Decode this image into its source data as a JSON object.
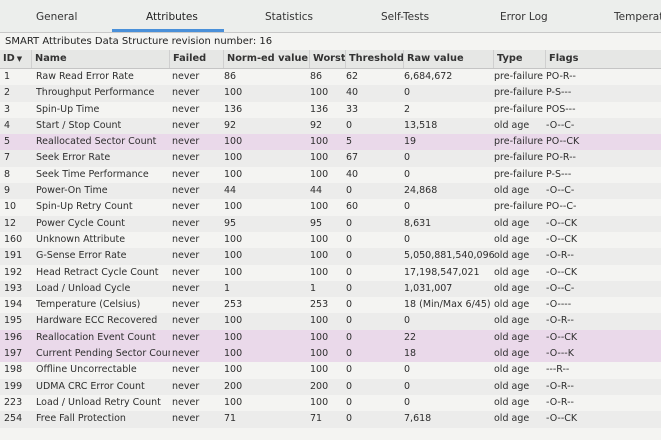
{
  "tabs": [
    {
      "label": "General"
    },
    {
      "label": "Attributes"
    },
    {
      "label": "Statistics"
    },
    {
      "label": "Self-Tests"
    },
    {
      "label": "Error Log"
    },
    {
      "label": "Temperatu"
    }
  ],
  "active_tab": "Attributes",
  "revision_text": "SMART Attributes Data Structure revision number: 16",
  "columns": [
    "ID",
    "Name",
    "Failed",
    "Norm-ed value",
    "Worst",
    "Threshold",
    "Raw value",
    "Type",
    "Flags"
  ],
  "sort_indicator": "▼",
  "rows": [
    {
      "id": "1",
      "name": "Raw Read Error Rate",
      "failed": "never",
      "norm": "86",
      "worst": "86",
      "threshold": "62",
      "raw": "6,684,672",
      "type": "pre-failure",
      "flags": "PO-R--"
    },
    {
      "id": "2",
      "name": "Throughput Performance",
      "failed": "never",
      "norm": "100",
      "worst": "100",
      "threshold": "40",
      "raw": "0",
      "type": "pre-failure",
      "flags": "P-S---"
    },
    {
      "id": "3",
      "name": "Spin-Up Time",
      "failed": "never",
      "norm": "136",
      "worst": "136",
      "threshold": "33",
      "raw": "2",
      "type": "pre-failure",
      "flags": "POS---"
    },
    {
      "id": "4",
      "name": "Start / Stop Count",
      "failed": "never",
      "norm": "92",
      "worst": "92",
      "threshold": "0",
      "raw": "13,518",
      "type": "old age",
      "flags": "-O--C-"
    },
    {
      "id": "5",
      "name": "Reallocated Sector Count",
      "failed": "never",
      "norm": "100",
      "worst": "100",
      "threshold": "5",
      "raw": "19",
      "type": "pre-failure",
      "flags": "PO--CK"
    },
    {
      "id": "7",
      "name": "Seek Error Rate",
      "failed": "never",
      "norm": "100",
      "worst": "100",
      "threshold": "67",
      "raw": "0",
      "type": "pre-failure",
      "flags": "PO-R--"
    },
    {
      "id": "8",
      "name": "Seek Time Performance",
      "failed": "never",
      "norm": "100",
      "worst": "100",
      "threshold": "40",
      "raw": "0",
      "type": "pre-failure",
      "flags": "P-S---"
    },
    {
      "id": "9",
      "name": "Power-On Time",
      "failed": "never",
      "norm": "44",
      "worst": "44",
      "threshold": "0",
      "raw": "24,868",
      "type": "old age",
      "flags": "-O--C-"
    },
    {
      "id": "10",
      "name": "Spin-Up Retry Count",
      "failed": "never",
      "norm": "100",
      "worst": "100",
      "threshold": "60",
      "raw": "0",
      "type": "pre-failure",
      "flags": "PO--C-"
    },
    {
      "id": "12",
      "name": "Power Cycle Count",
      "failed": "never",
      "norm": "95",
      "worst": "95",
      "threshold": "0",
      "raw": "8,631",
      "type": "old age",
      "flags": "-O--CK"
    },
    {
      "id": "160",
      "name": "Unknown Attribute",
      "failed": "never",
      "norm": "100",
      "worst": "100",
      "threshold": "0",
      "raw": "0",
      "type": "old age",
      "flags": "-O--CK"
    },
    {
      "id": "191",
      "name": "G-Sense Error Rate",
      "failed": "never",
      "norm": "100",
      "worst": "100",
      "threshold": "0",
      "raw": "5,050,881,540,096",
      "type": "old age",
      "flags": "-O-R--"
    },
    {
      "id": "192",
      "name": "Head Retract Cycle Count",
      "failed": "never",
      "norm": "100",
      "worst": "100",
      "threshold": "0",
      "raw": "17,198,547,021",
      "type": "old age",
      "flags": "-O--CK"
    },
    {
      "id": "193",
      "name": "Load / Unload Cycle",
      "failed": "never",
      "norm": "1",
      "worst": "1",
      "threshold": "0",
      "raw": "1,031,007",
      "type": "old age",
      "flags": "-O--C-"
    },
    {
      "id": "194",
      "name": "Temperature (Celsius)",
      "failed": "never",
      "norm": "253",
      "worst": "253",
      "threshold": "0",
      "raw": "18 (Min/Max 6/45)",
      "type": "old age",
      "flags": "-O----"
    },
    {
      "id": "195",
      "name": "Hardware ECC Recovered",
      "failed": "never",
      "norm": "100",
      "worst": "100",
      "threshold": "0",
      "raw": "0",
      "type": "old age",
      "flags": "-O-R--"
    },
    {
      "id": "196",
      "name": "Reallocation Event Count",
      "failed": "never",
      "norm": "100",
      "worst": "100",
      "threshold": "0",
      "raw": "22",
      "type": "old age",
      "flags": "-O--CK"
    },
    {
      "id": "197",
      "name": "Current Pending Sector Count",
      "failed": "never",
      "norm": "100",
      "worst": "100",
      "threshold": "0",
      "raw": "18",
      "type": "old age",
      "flags": "-O---K"
    },
    {
      "id": "198",
      "name": "Offline Uncorrectable",
      "failed": "never",
      "norm": "100",
      "worst": "100",
      "threshold": "0",
      "raw": "0",
      "type": "old age",
      "flags": "---R--"
    },
    {
      "id": "199",
      "name": "UDMA CRC Error Count",
      "failed": "never",
      "norm": "200",
      "worst": "200",
      "threshold": "0",
      "raw": "0",
      "type": "old age",
      "flags": "-O-R--"
    },
    {
      "id": "223",
      "name": "Load / Unload Retry Count",
      "failed": "never",
      "norm": "100",
      "worst": "100",
      "threshold": "0",
      "raw": "0",
      "type": "old age",
      "flags": "-O-R--"
    },
    {
      "id": "254",
      "name": "Free Fall Protection",
      "failed": "never",
      "norm": "71",
      "worst": "71",
      "threshold": "0",
      "raw": "7,618",
      "type": "old age",
      "flags": "-O--CK"
    }
  ],
  "highlighted_row_ids": [
    "5",
    "196",
    "197"
  ],
  "colors": {
    "highlight_row": "#ead9ea",
    "tab_underline": "#4a90d9"
  }
}
